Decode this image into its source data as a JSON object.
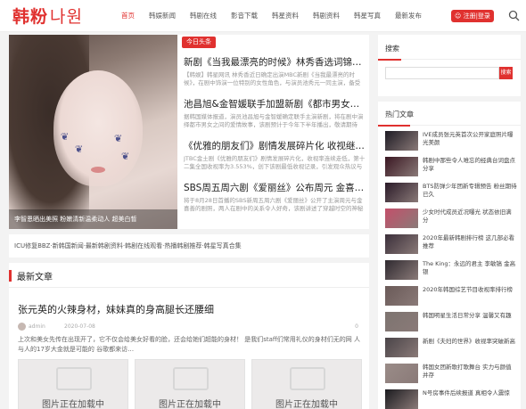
{
  "brand": {
    "name": "韩粉",
    "name_suffix": "나원",
    "accent": "#e0312f"
  },
  "nav": [
    {
      "label": "首页",
      "active": true
    },
    {
      "label": "韩娱新闻"
    },
    {
      "label": "韩剧在线"
    },
    {
      "label": "影音下载"
    },
    {
      "label": "韩星资料"
    },
    {
      "label": "韩剧资料"
    },
    {
      "label": "韩星写真"
    },
    {
      "label": "最新发布"
    }
  ],
  "header": {
    "login_label": "☺ 注册|登录"
  },
  "hero": {
    "caption": "李智恩晒出美照 粉嫩清新温柔动人 超美白皙"
  },
  "top": {
    "badge": "今日头条",
    "items": [
      {
        "title": "新剧《当我最漂亮的时候》林秀香选词锦…",
        "desc": "【韩娱】韩星网讯 林秀香近日确定出演MBC新剧《当我最漂亮的时候》，在剧中饰演一位特别的女性角色，与演员池秀元一同主演，备受关注的一部作品…"
      },
      {
        "title": "池昌旭&金智媛联手加盟新剧《都市男女…",
        "desc": "据韩国媒体报道，演员池昌旭与金智媛确定联手主演新剧，将在剧中演绎都市男女之间的爱情故事，该剧预计于今年下半年播出，敬请期待《都市男女》…"
      },
      {
        "title": "《优雅的朋友们》剧情发展碎片化 收视继…",
        "desc": "JTBC金土剧《优雅的朋友们》剧情发展碎片化，收视率连续走低，第十二集全国收视率为3.553%，创下该剧最低收视记录，引发观众热议与讨论…"
      },
      {
        "title": "SBS周五周六剧《爱丽丝》公布周元 金喜…",
        "desc": "将于8月28日首播的SBS新周五周六剧《爱丽丝》公开了主演周元与金喜善的剧照，两人在剧中的关系令人好奇，该剧讲述了穿越时空的神秘故事…"
      }
    ]
  },
  "ticker": {
    "text": "ICU修复BBZ·新韩国新闻·最新韩剧资料·韩剧在线观看·热播韩剧推荐·韩星写真合集"
  },
  "latest": {
    "heading": "最新文章",
    "article": {
      "title": "张元英的火辣身材，妹妹真的身高腿长还腰细",
      "author": "admin",
      "date": "2020-07-08",
      "comments": "0",
      "excerpt": "上次和美女先传在出现开了，它不仅会给美女好看的脸，还会给她们超能的身材！ 是我们staff们常用礼仪的身材们无的网    人与人的17岁大金就是可能的     谷歌都来访…"
    },
    "placeholder": "图片正在加载中"
  },
  "search": {
    "title": "搜索",
    "placeholder": "",
    "button": "搜索"
  },
  "hot": {
    "title": "热门文章",
    "items": [
      {
        "text": "IVE成员张元英首次公开家庭照片曝光美颜",
        "color": "#1e1b24"
      },
      {
        "text": "韩剧中那些令人难忘的经典台词盘点分享",
        "color": "#3a1722"
      },
      {
        "text": "BTS防弹少年团新专辑预告 粉丝期待已久",
        "color": "#2a1a28"
      },
      {
        "text": "少女时代成员近况曝光 状态依旧满分",
        "color": "#c44f6a"
      },
      {
        "text": "2020年最新韩剧排行榜 这几部必看推荐",
        "color": "#3b2f3a"
      },
      {
        "text": "The King：永远的君主 李敏镐 金高银",
        "color": "#2f2a30"
      },
      {
        "text": "2020年韩国综艺节目收视率排行榜",
        "color": "#6a5a58"
      },
      {
        "text": "韩国明星生活日常分享 温馨又有趣",
        "color": "#7d7470"
      },
      {
        "text": "新剧《夫妇的世界》收视率突破新高",
        "color": "#4a4448"
      },
      {
        "text": "韩国女团新歌打歌舞台 实力与颜值并存",
        "color": "#9a8c88"
      },
      {
        "text": "N号房事件后续报道 真相令人震惊",
        "color": "#1b1b1f"
      }
    ]
  }
}
